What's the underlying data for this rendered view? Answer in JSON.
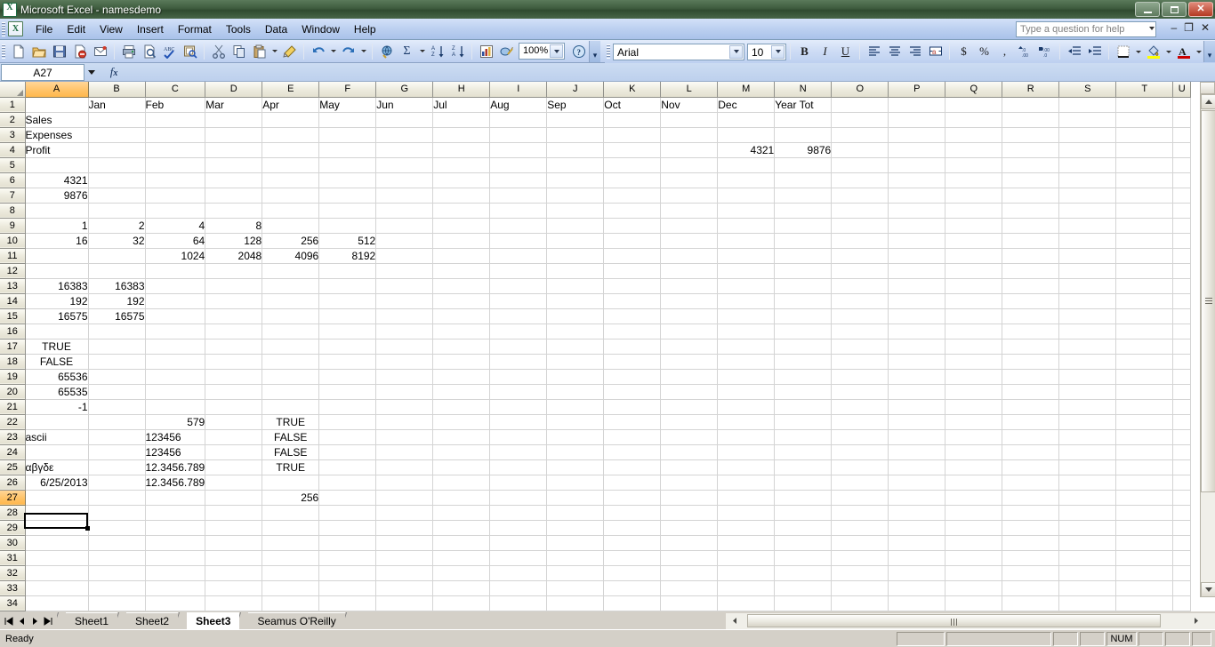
{
  "window": {
    "title": "Microsoft Excel - namesdemo",
    "app_icon": "excel-icon",
    "minimize_label": "Minimize",
    "restore_label": "Restore",
    "close_label": "Close"
  },
  "menubar": {
    "items": [
      "File",
      "Edit",
      "View",
      "Insert",
      "Format",
      "Tools",
      "Data",
      "Window",
      "Help"
    ],
    "help_placeholder": "Type a question for help",
    "doc_minimize": "–",
    "doc_restore": "❐",
    "doc_close": "✕"
  },
  "toolbar": {
    "zoom": "100%",
    "font_name": "Arial",
    "font_size": "10",
    "bold_label": "B",
    "italic_label": "I",
    "underline_label": "U",
    "currency_label": "$",
    "percent_label": "%",
    "comma_label": ",",
    "icons": [
      "new-icon",
      "open-icon",
      "save-icon",
      "permission-icon",
      "email-icon",
      "print-icon",
      "print-preview-icon",
      "spelling-icon",
      "research-icon",
      "cut-icon",
      "copy-icon",
      "paste-icon",
      "format-painter-icon",
      "undo-icon",
      "redo-icon",
      "hyperlink-icon",
      "autosum-icon",
      "sort-asc-icon",
      "sort-desc-icon",
      "chart-icon",
      "drawing-icon",
      "help-icon"
    ]
  },
  "formulabar": {
    "name_box": "A27",
    "fx_label": "fx",
    "formula_value": ""
  },
  "grid": {
    "columns": [
      "A",
      "B",
      "C",
      "D",
      "E",
      "F",
      "G",
      "H",
      "I",
      "J",
      "K",
      "L",
      "M",
      "N",
      "O",
      "P",
      "Q",
      "R",
      "S",
      "T",
      "U"
    ],
    "selected_column": "A",
    "selected_cell": "A27",
    "rows": [
      1,
      2,
      3,
      4,
      5,
      6,
      7,
      8,
      9,
      10,
      11,
      12,
      13,
      14,
      15,
      16,
      17,
      18,
      19,
      20,
      21,
      22,
      23,
      24,
      25,
      26,
      27,
      28,
      29,
      30,
      31,
      32,
      33,
      34
    ],
    "cells": {
      "B1": {
        "v": "Jan",
        "a": "l"
      },
      "C1": {
        "v": "Feb",
        "a": "l"
      },
      "D1": {
        "v": "Mar",
        "a": "l"
      },
      "E1": {
        "v": "Apr",
        "a": "l"
      },
      "F1": {
        "v": "May",
        "a": "l"
      },
      "G1": {
        "v": "Jun",
        "a": "l"
      },
      "H1": {
        "v": "Jul",
        "a": "l"
      },
      "I1": {
        "v": "Aug",
        "a": "l"
      },
      "J1": {
        "v": "Sep",
        "a": "l"
      },
      "K1": {
        "v": "Oct",
        "a": "l"
      },
      "L1": {
        "v": "Nov",
        "a": "l"
      },
      "M1": {
        "v": "Dec",
        "a": "l"
      },
      "N1": {
        "v": "Year Tot",
        "a": "l"
      },
      "A2": {
        "v": "Sales",
        "a": "l"
      },
      "A3": {
        "v": "Expenses",
        "a": "l"
      },
      "A4": {
        "v": "Profit",
        "a": "l"
      },
      "M4": {
        "v": "4321",
        "a": "r"
      },
      "N4": {
        "v": "9876",
        "a": "r"
      },
      "A6": {
        "v": "4321",
        "a": "r"
      },
      "A7": {
        "v": "9876",
        "a": "r"
      },
      "A9": {
        "v": "1",
        "a": "r"
      },
      "B9": {
        "v": "2",
        "a": "r"
      },
      "C9": {
        "v": "4",
        "a": "r"
      },
      "D9": {
        "v": "8",
        "a": "r"
      },
      "A10": {
        "v": "16",
        "a": "r"
      },
      "B10": {
        "v": "32",
        "a": "r"
      },
      "C10": {
        "v": "64",
        "a": "r"
      },
      "D10": {
        "v": "128",
        "a": "r"
      },
      "E10": {
        "v": "256",
        "a": "r"
      },
      "F10": {
        "v": "512",
        "a": "r"
      },
      "C11": {
        "v": "1024",
        "a": "r"
      },
      "D11": {
        "v": "2048",
        "a": "r"
      },
      "E11": {
        "v": "4096",
        "a": "r"
      },
      "F11": {
        "v": "8192",
        "a": "r"
      },
      "A13": {
        "v": "16383",
        "a": "r"
      },
      "B13": {
        "v": "16383",
        "a": "r"
      },
      "A14": {
        "v": "192",
        "a": "r"
      },
      "B14": {
        "v": "192",
        "a": "r"
      },
      "A15": {
        "v": "16575",
        "a": "r"
      },
      "B15": {
        "v": "16575",
        "a": "r"
      },
      "A17": {
        "v": "TRUE",
        "a": "c"
      },
      "A18": {
        "v": "FALSE",
        "a": "c"
      },
      "A19": {
        "v": "65536",
        "a": "r"
      },
      "A20": {
        "v": "65535",
        "a": "r"
      },
      "A21": {
        "v": "-1",
        "a": "r"
      },
      "C22": {
        "v": "579",
        "a": "r"
      },
      "E22": {
        "v": "TRUE",
        "a": "c"
      },
      "A23": {
        "v": "ascii",
        "a": "l"
      },
      "C23": {
        "v": "123456",
        "a": "l"
      },
      "E23": {
        "v": "FALSE",
        "a": "c"
      },
      "C24": {
        "v": "123456",
        "a": "l"
      },
      "E24": {
        "v": "FALSE",
        "a": "c"
      },
      "A25": {
        "v": "αβγδε",
        "a": "l"
      },
      "C25": {
        "v": "12.3456.789",
        "a": "l"
      },
      "E25": {
        "v": "TRUE",
        "a": "c"
      },
      "A26": {
        "v": "6/25/2013",
        "a": "r"
      },
      "C26": {
        "v": "12.3456.789",
        "a": "l"
      },
      "E27": {
        "v": "256",
        "a": "r"
      }
    }
  },
  "sheettabs": {
    "first_label": "⏮",
    "prev_label": "◀",
    "next_label": "▶",
    "last_label": "⏭",
    "tabs": [
      {
        "label": "Sheet1",
        "active": false
      },
      {
        "label": "Sheet2",
        "active": false
      },
      {
        "label": "Sheet3",
        "active": true
      },
      {
        "label": "Seamus O'Reilly",
        "active": false
      }
    ]
  },
  "statusbar": {
    "message": "Ready",
    "num_indicator": "NUM"
  }
}
